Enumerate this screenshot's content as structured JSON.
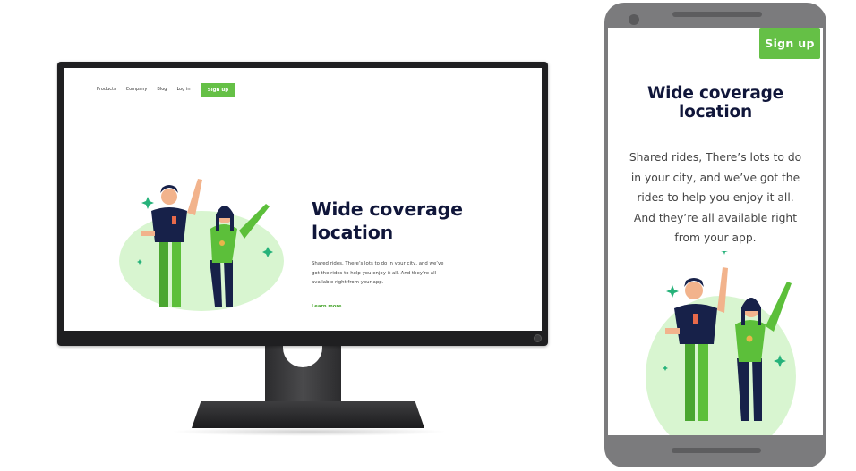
{
  "desktop": {
    "nav": {
      "items": [
        {
          "label": "Products"
        },
        {
          "label": "Company"
        },
        {
          "label": "Blog"
        },
        {
          "label": "Log in"
        }
      ],
      "signup_label": "Sign up"
    },
    "hero": {
      "title": "Wide coverage location",
      "description": "Shared rides, There’s lots to do in your city, and we’ve got the rides to help you enjoy it all. And they’re all available right from your app.",
      "link_label": "Learn more"
    }
  },
  "mobile": {
    "signup_label": "Sign up",
    "hero": {
      "title": "Wide coverage location",
      "description": "Shared rides, There’s lots to do in your city, and we’ve got the rides to help you enjoy it all. And they’re all available right from your app."
    }
  },
  "colors": {
    "accent_green": "#65c046",
    "heading_navy": "#10163a",
    "illustration_bg": "#d8f5d0"
  }
}
